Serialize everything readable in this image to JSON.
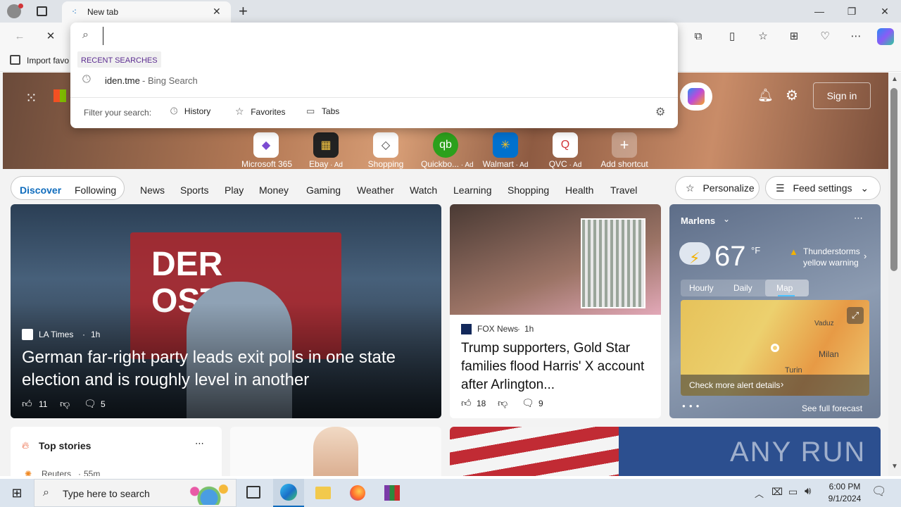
{
  "browser": {
    "tab_title": "New tab",
    "favorites_bar_item": "Import favo",
    "sign_in": "Sign in"
  },
  "omnibox": {
    "value": "",
    "recent_header": "RECENT SEARCHES",
    "recent_item": "iden.tme",
    "recent_item_suffix": " - Bing Search",
    "filter_label": "Filter your search:",
    "filters": [
      "History",
      "Favorites",
      "Tabs"
    ]
  },
  "shortcuts": [
    {
      "label": "Microsoft 365",
      "icon": "m365-icon",
      "ad": ""
    },
    {
      "label": "Ebay",
      "icon": "ebay-icon",
      "ad": " · Ad"
    },
    {
      "label": "Shopping",
      "icon": "shopping-tag-icon",
      "ad": ""
    },
    {
      "label": "Quickbo...",
      "icon": "quickbooks-icon",
      "ad": " · Ad"
    },
    {
      "label": "Walmart",
      "icon": "walmart-icon",
      "ad": " · Ad"
    },
    {
      "label": "QVC",
      "icon": "qvc-icon",
      "ad": " · Ad"
    },
    {
      "label": "Add shortcut",
      "icon": "plus-icon",
      "ad": ""
    }
  ],
  "feed_nav": {
    "discover": "Discover",
    "following": "Following",
    "items": [
      "News",
      "Sports",
      "Play",
      "Money",
      "Gaming",
      "Weather",
      "Watch",
      "Learning",
      "Shopping",
      "Health",
      "Travel"
    ],
    "personalize": "Personalize",
    "feed_settings": "Feed settings"
  },
  "main_story": {
    "source": "LA Times",
    "age": "1h",
    "headline": "German far-right party leads exit polls in one state election and is roughly level in another",
    "likes": "11",
    "comments": "5",
    "image_text": "DER OSTEN"
  },
  "story2": {
    "source": "FOX News",
    "age": "1h",
    "headline": "Trump supporters, Gold Star families flood Harris' X account after Arlington...",
    "likes": "18",
    "comments": "9"
  },
  "weather": {
    "location": "Marlens",
    "temp": "67",
    "unit": "°F",
    "alert_line1": "Thunderstorms",
    "alert_line2": "yellow warning",
    "tabs": [
      "Hourly",
      "Daily",
      "Map"
    ],
    "active_tab": "Map",
    "alert_link": "Check more alert details",
    "forecast_link": "See full forecast",
    "map_city": "Milan",
    "map_city2": "Turin",
    "map_city3": "Vaduz"
  },
  "top_stories": {
    "title": "Top stories",
    "source": "Reuters",
    "age": "55m"
  },
  "watermark": "ANY RUN",
  "taskbar": {
    "search_placeholder": "Type here to search",
    "time": "6:00 PM",
    "date": "9/1/2024"
  },
  "colors": {
    "accent": "#0f6cbd",
    "alert": "#f2b100",
    "map_yellow": "#e9c95a",
    "map_orange": "#e79a45"
  }
}
